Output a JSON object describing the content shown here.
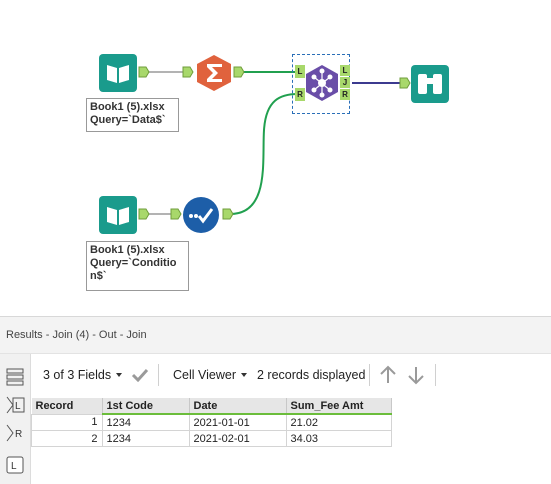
{
  "workflow": {
    "input1": {
      "annotation_line1": "Book1 (5).xlsx",
      "annotation_line2": "Query=`Data$`"
    },
    "input2": {
      "annotation_line1": "Book1 (5).xlsx",
      "annotation_line2": "Query=`Conditio",
      "annotation_line3": "n$`"
    },
    "join": {
      "left_anchor": "L",
      "right_anchor": "R",
      "out_left": "L",
      "out_join": "J",
      "out_right": "R"
    },
    "colors": {
      "input": "#1a9b8c",
      "summarize": "#e0623d",
      "formula": "#1d5ea8",
      "join": "#6a4ea8",
      "browse": "#1a9b8c",
      "connector": "#21a04f",
      "join_out_line": "#3c3a8f",
      "anchor": "#a8d86b"
    }
  },
  "results": {
    "title": "Results - Join (4) - Out - Join",
    "fields_label": "3 of 3 Fields",
    "viewer_label": "Cell Viewer",
    "records_label": "2 records displayed",
    "side_L": "L",
    "side_R": "R",
    "side_L2": "L",
    "table": {
      "headers": [
        "Record",
        "1st Code",
        "Date",
        "Sum_Fee Amt"
      ],
      "rows": [
        [
          "1",
          "1234",
          "2021-01-01",
          "21.02"
        ],
        [
          "2",
          "1234",
          "2021-02-01",
          "34.03"
        ]
      ]
    }
  }
}
